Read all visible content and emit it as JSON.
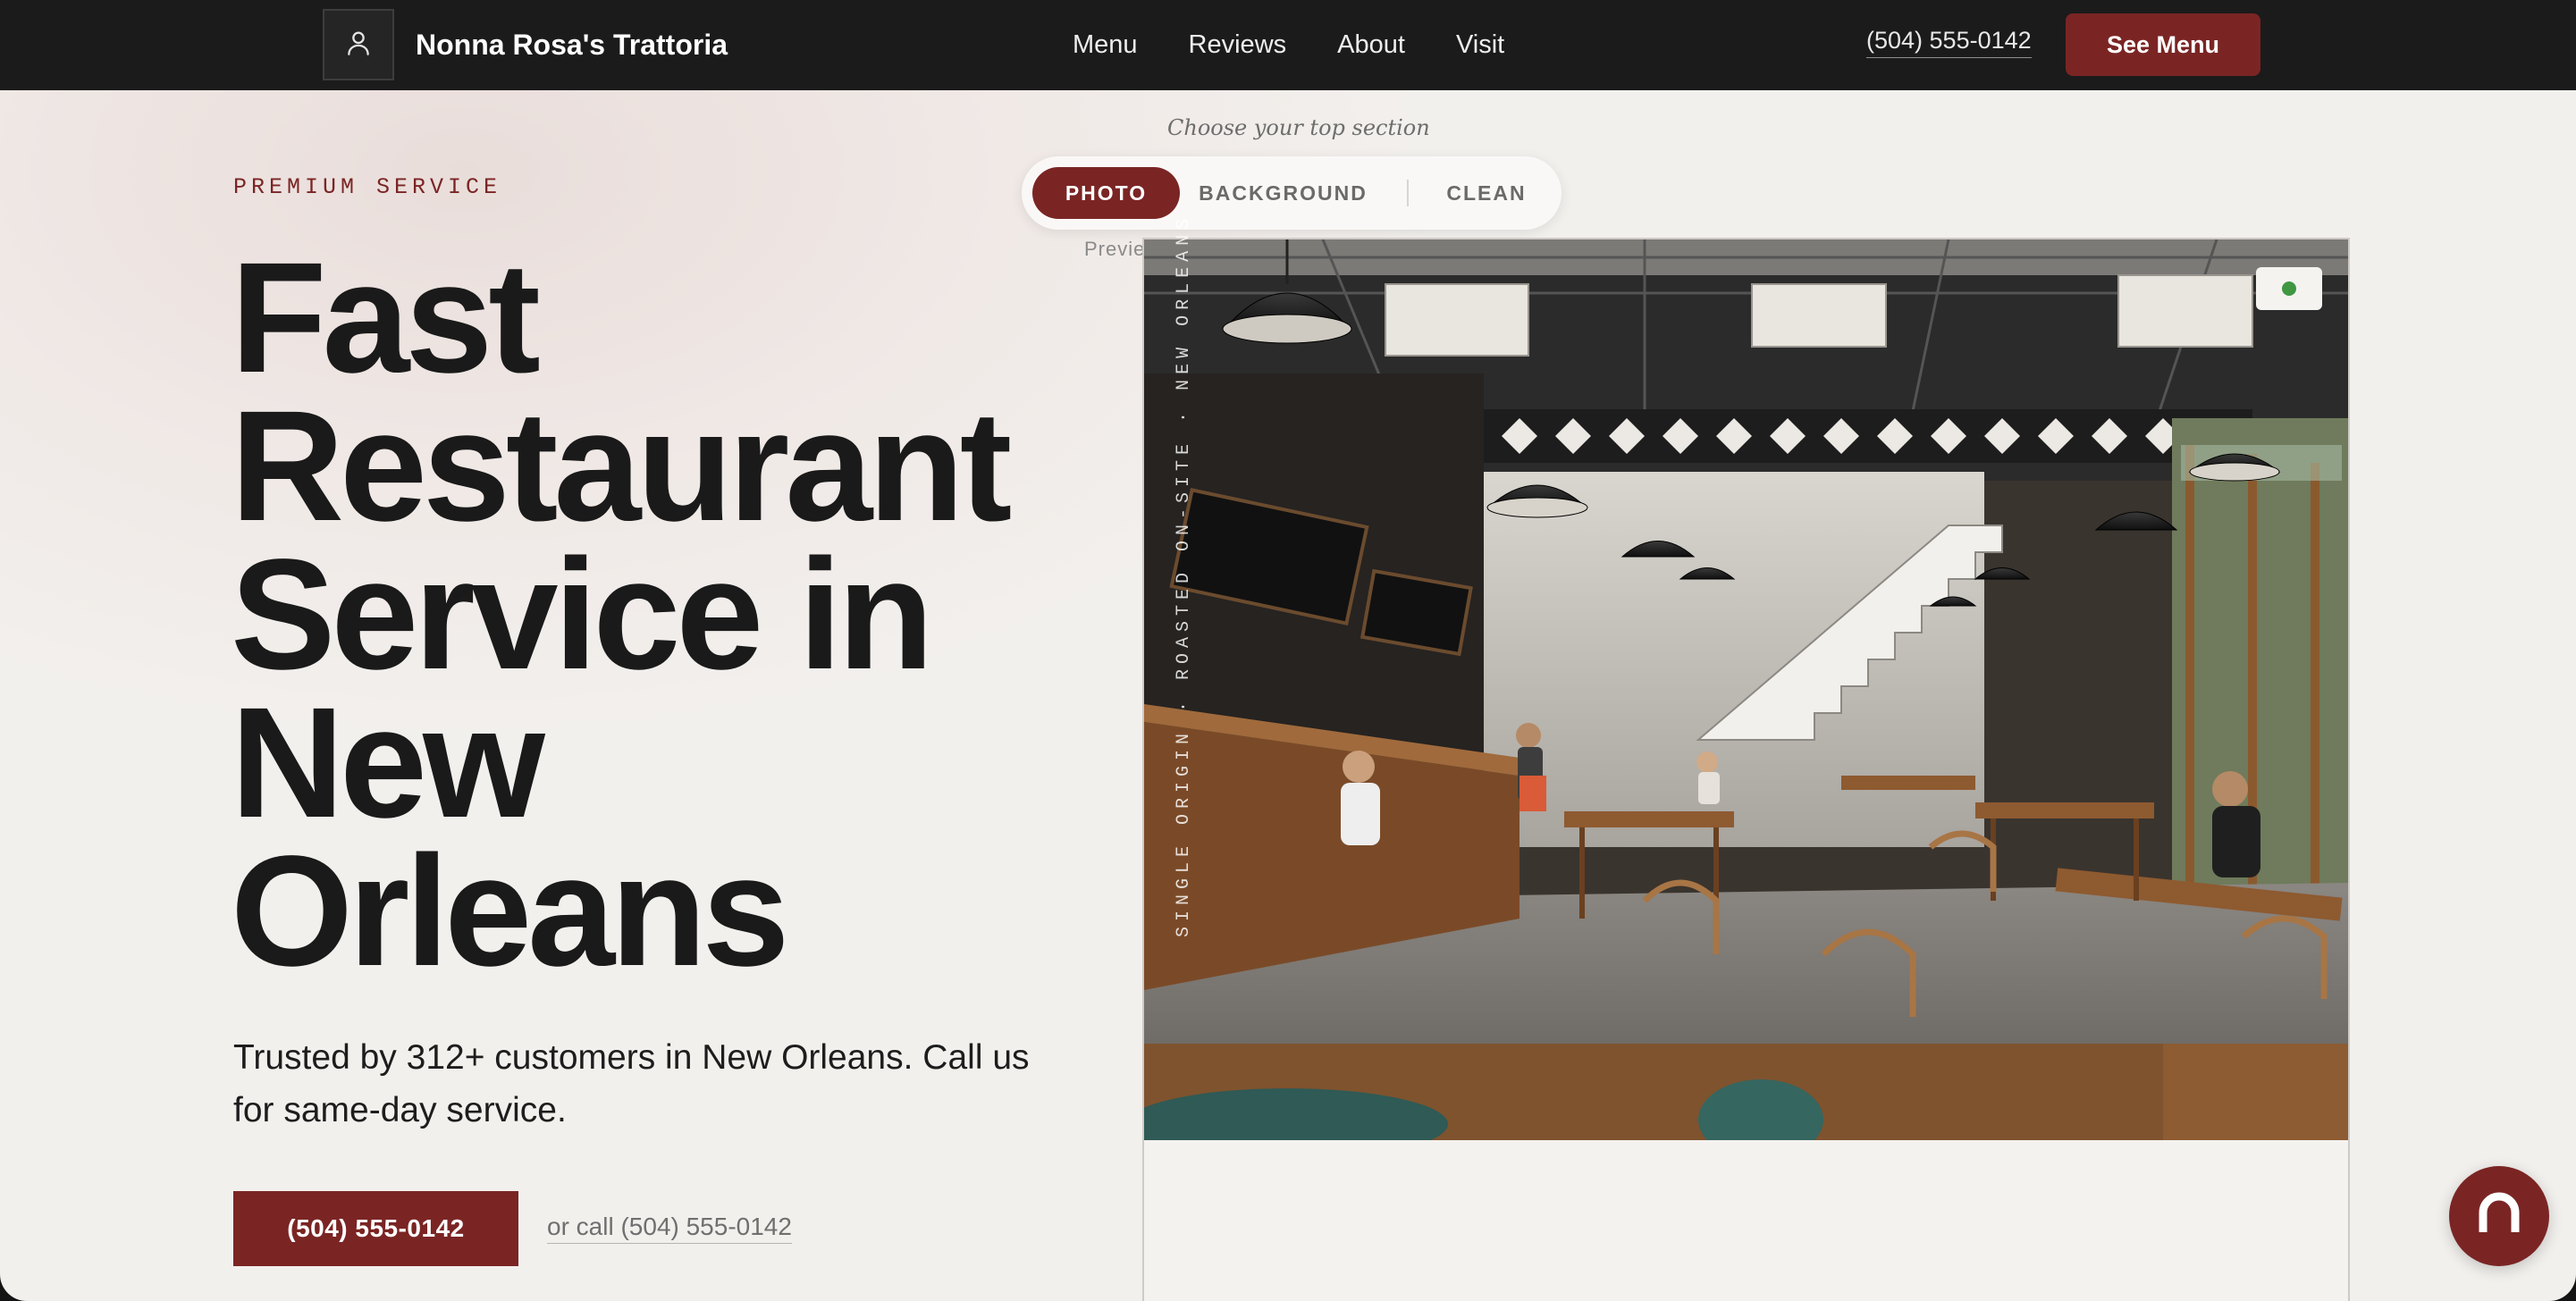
{
  "header": {
    "logo_icon": "user-icon",
    "brand": "Nonna Rosa's Trattoria",
    "nav": [
      "Menu",
      "Reviews",
      "About",
      "Visit"
    ],
    "phone": "(504) 555-0142",
    "cta": "See Menu"
  },
  "hero": {
    "eyebrow": "PREMIUM SERVICE",
    "headline": [
      "Fast",
      "Restaurant",
      "Service in",
      "New",
      "Orleans"
    ],
    "subtitle_lines": [
      "Trusted by 312+ customers in New Orleans. Call us",
      "for same-day service."
    ],
    "cta_phone": "(504) 555-0142",
    "alt_call": "or call (504) 555-0142"
  },
  "section_picker": {
    "prompt": "Choose your top section",
    "options": [
      "PHOTO",
      "BACKGROUND",
      "CLEAN"
    ],
    "selected": "PHOTO",
    "preview_label": "Previe"
  },
  "photo_card": {
    "vertical_caption": "SINGLE ORIGIN · ROASTED ON-SITE · NEW ORLEANS",
    "status_color": "#3f9742"
  },
  "chat_button": {
    "icon": "chat-bubble-icon"
  },
  "colors": {
    "accent": "#7a2524",
    "topbar": "#1b1b1b",
    "ink": "#1a1a1a"
  }
}
